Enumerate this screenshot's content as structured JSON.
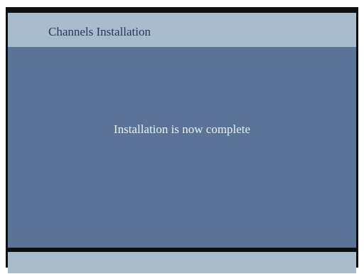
{
  "header": {
    "title": "Channels Installation"
  },
  "main": {
    "message": "Installation is now complete"
  },
  "colors": {
    "header_bar": "#a9bccc",
    "header_text": "#1f3a5c",
    "content_panel": "#5a7397",
    "message_text": "#eaf0f6",
    "screen_border": "#0e0f12"
  }
}
